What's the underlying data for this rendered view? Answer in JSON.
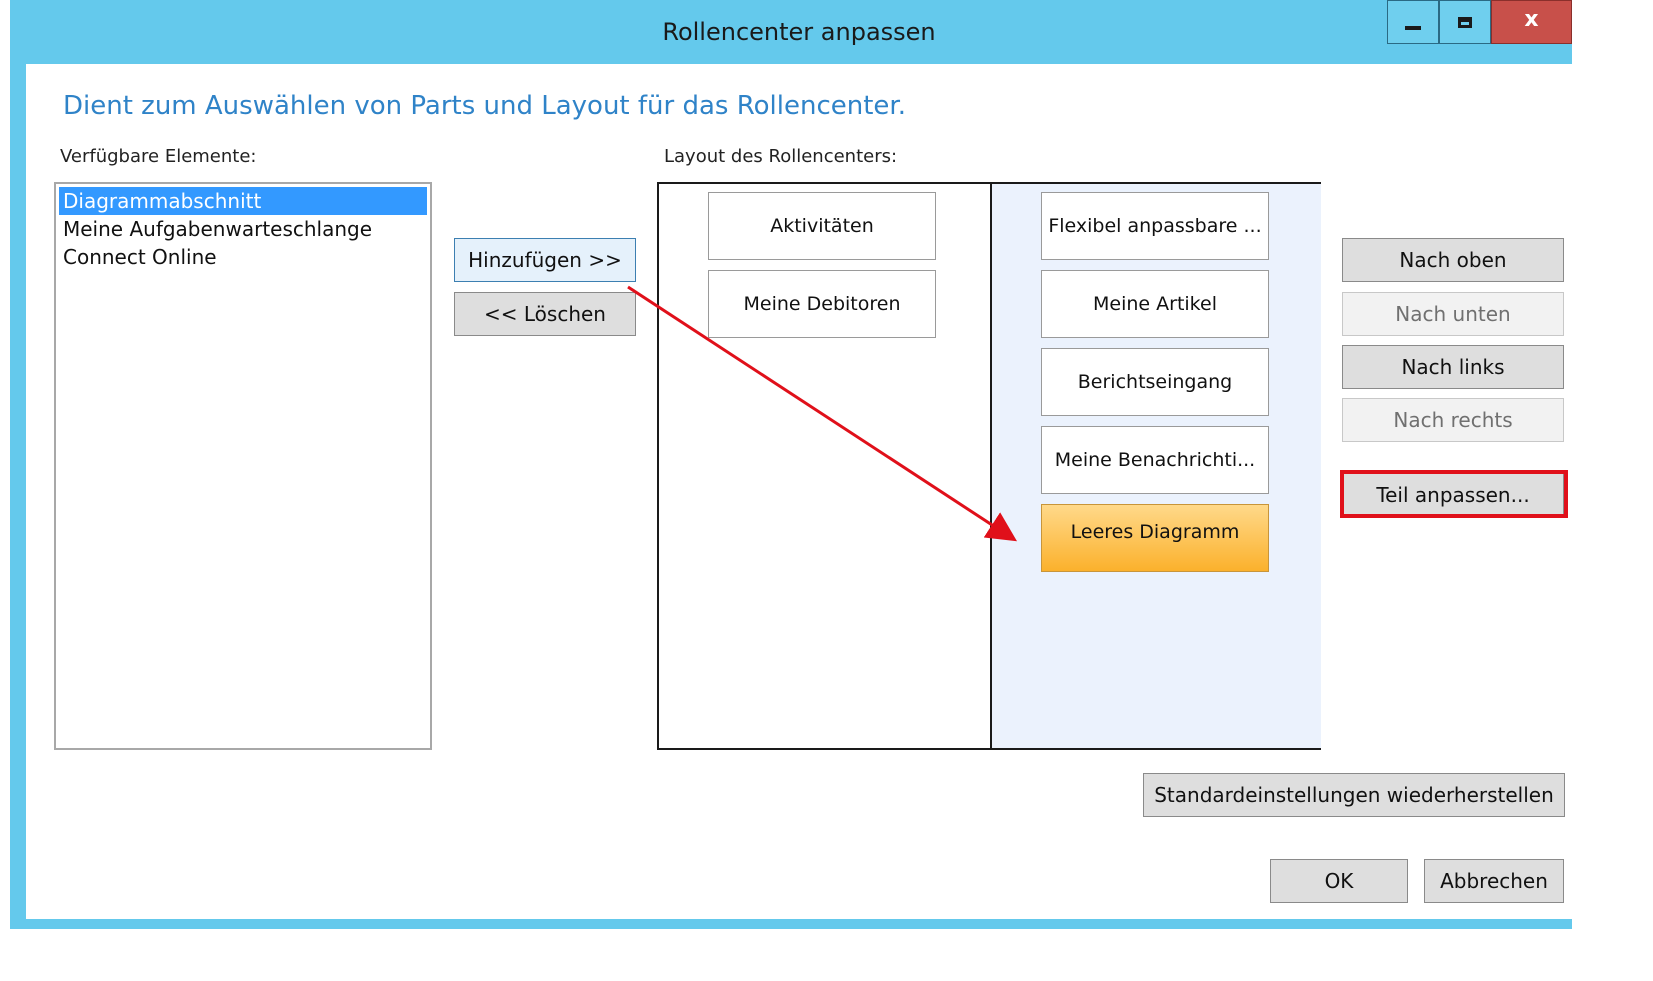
{
  "window": {
    "title": "Rollencenter anpassen",
    "controls": {
      "minimize": "minimize-icon",
      "maximize": "maximize-icon",
      "close": "x"
    },
    "accent_color": "#64c9ec"
  },
  "header": {
    "text": "Dient zum Auswählen von Parts und Layout für das Rollencenter."
  },
  "available": {
    "label": "Verfügbare Elemente:",
    "items": [
      "Diagrammabschnitt",
      "Meine Aufgabenwarteschlange",
      "Connect Online"
    ],
    "selected": "Diagrammabschnitt"
  },
  "actions": {
    "add_label": "Hinzufügen >>",
    "delete_label": "<< Löschen"
  },
  "layout": {
    "label": "Layout des Rollencenters:",
    "left_column": [
      "Aktivitäten",
      "Meine Debitoren"
    ],
    "right_column": [
      "Flexibel anpassbare ...",
      "Meine Artikel",
      "Berichtseingang",
      "Meine Benachrichti...",
      "Leeres Diagramm"
    ],
    "highlighted_part": "Leeres Diagramm"
  },
  "move_buttons": {
    "up": "Nach oben",
    "down": "Nach unten",
    "left": "Nach links",
    "right": "Nach rechts",
    "customize": "Teil anpassen..."
  },
  "footer": {
    "reset": "Standardeinstellungen wiederherstellen",
    "ok": "OK",
    "cancel": "Abbrechen"
  },
  "annotation_color": "#e0101a"
}
